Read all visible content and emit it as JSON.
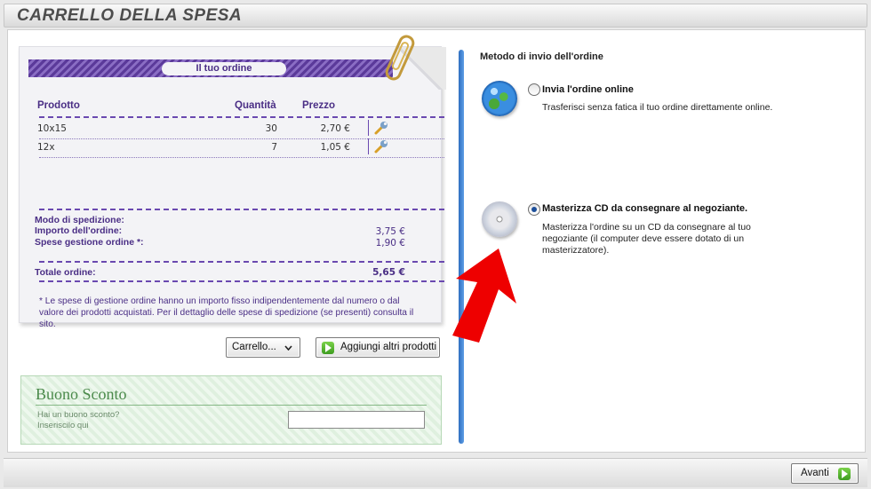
{
  "header": {
    "title": "CARRELLO DELLA SPESA"
  },
  "order": {
    "title": "Il tuo ordine",
    "columns": {
      "product": "Prodotto",
      "quantity": "Quantità",
      "price": "Prezzo"
    },
    "rows": [
      {
        "product": "10x15",
        "quantity": "30",
        "price": "2,70 €"
      },
      {
        "product": "12x",
        "quantity": "7",
        "price": "1,05 €"
      }
    ],
    "shipping_label": "Modo di spedizione:",
    "amount_label": "Importo dell'ordine:",
    "amount_value": "3,75 €",
    "fees_label": "Spese gestione ordine *:",
    "fees_value": "1,90 €",
    "total_label": "Totale ordine:",
    "total_value": "5,65 €",
    "note": "* Le spese di gestione ordine hanno un importo fisso indipendentemente dal numero o dal valore dei prodotti acquistati. Per il dettaglio delle spese di spedizione (se presenti) consulta il sito."
  },
  "buttons": {
    "cart": "Carrello...",
    "add_products": "Aggiungi altri prodotti",
    "next": "Avanti"
  },
  "coupon": {
    "title": "Buono Sconto",
    "question": "Hai un buono sconto?",
    "hint": "Inseriscilo qui",
    "value": ""
  },
  "send_method": {
    "title": "Metodo di invio dell'ordine",
    "online": {
      "label": "Invia l'ordine online",
      "desc": "Trasferisci senza fatica il tuo ordine direttamente online.",
      "selected": false
    },
    "cd": {
      "label": "Masterizza CD da consegnare al negoziante.",
      "desc": "Masterizza l'ordine su un CD da consegnare al tuo negoziante (il computer deve essere dotato di un masterizzatore).",
      "selected": true
    }
  },
  "colors": {
    "accent_purple": "#4a2e85",
    "divider_blue": "#2f6fc0",
    "arrow_red": "#ee0000",
    "coupon_green": "#4b8a4b"
  },
  "icons": [
    "wrench-icon",
    "chevron-down-icon",
    "green-arrow-icon",
    "globe-icon",
    "cd-icon",
    "paperclip-icon",
    "red-arrow-icon"
  ]
}
